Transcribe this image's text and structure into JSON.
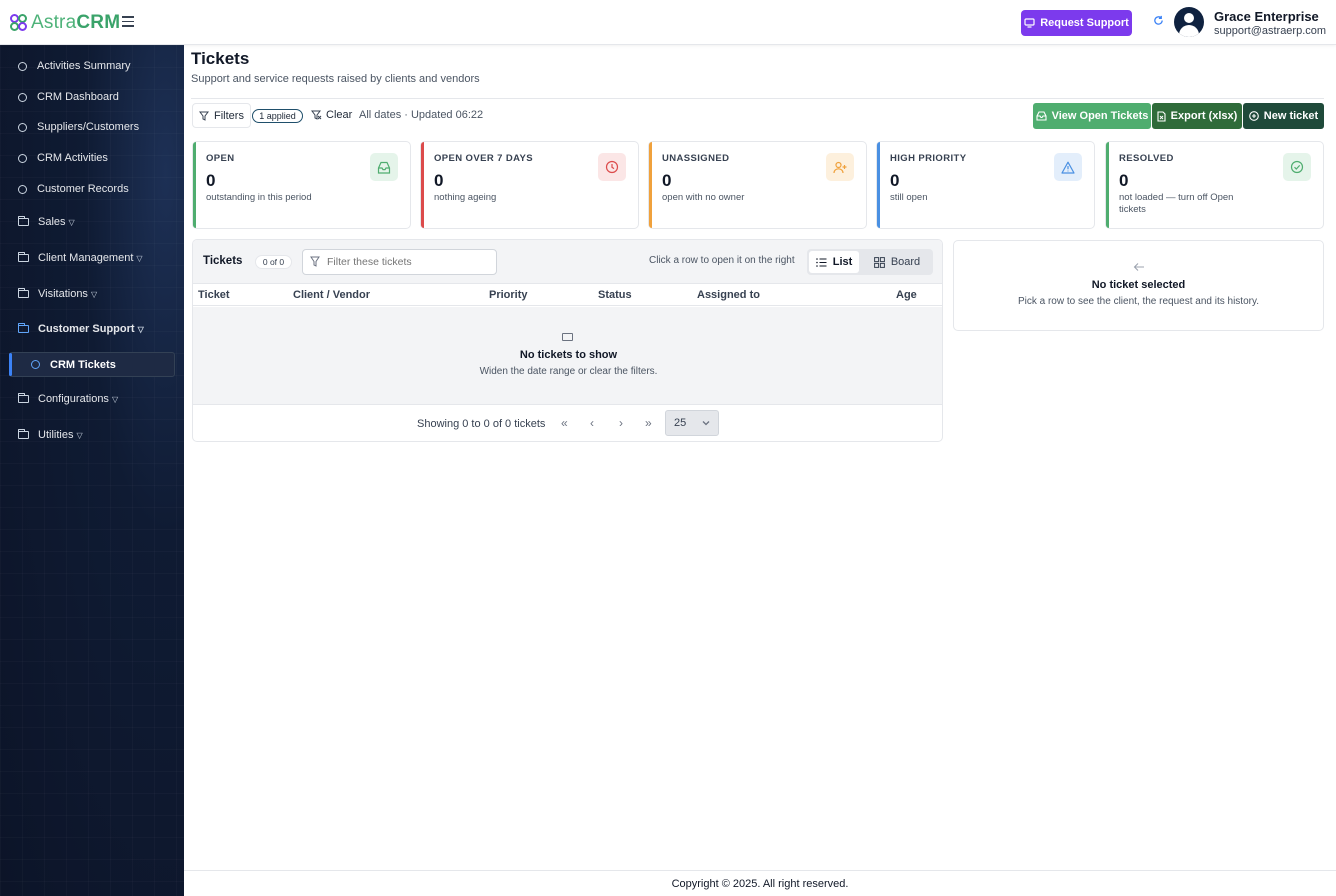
{
  "app": {
    "logo_prefix": "Astra",
    "logo_suffix": "CRM"
  },
  "header": {
    "request_support": "Request Support",
    "user_name": "Grace Enterprise",
    "user_email": "support@astraerp.com"
  },
  "sidebar": {
    "items": [
      {
        "label": "Activities Summary"
      },
      {
        "label": "CRM Dashboard"
      },
      {
        "label": "Suppliers/Customers"
      },
      {
        "label": "CRM Activities"
      },
      {
        "label": "Customer Records"
      },
      {
        "label": "Sales"
      },
      {
        "label": "Client Management"
      },
      {
        "label": "Visitations"
      },
      {
        "label": "Customer Support"
      },
      {
        "label": "CRM Tickets"
      },
      {
        "label": "Configurations"
      },
      {
        "label": "Utilities"
      }
    ]
  },
  "page": {
    "title": "Tickets",
    "subtitle": "Support and service requests raised by clients and vendors"
  },
  "toolbar": {
    "filters": "Filters",
    "applied": "1 applied",
    "clear": "Clear",
    "dates": "All dates · Updated 06:22",
    "view_open": "View Open Tickets",
    "export": "Export (xlsx)",
    "new_ticket": "New ticket"
  },
  "stats": [
    {
      "label": "OPEN",
      "value": "0",
      "note": "outstanding in this period",
      "color": "#4fad6f"
    },
    {
      "label": "OPEN OVER 7 DAYS",
      "value": "0",
      "note": "nothing ageing",
      "color": "#dc4b4b"
    },
    {
      "label": "UNASSIGNED",
      "value": "0",
      "note": "open with no owner",
      "color": "#f0a13c"
    },
    {
      "label": "HIGH PRIORITY",
      "value": "0",
      "note": "still open",
      "color": "#4a90e2"
    },
    {
      "label": "RESOLVED",
      "value": "0",
      "note": "not loaded — turn off Open tickets",
      "color": "#4fad6f"
    }
  ],
  "tickets": {
    "title": "Tickets",
    "count": "0 of 0",
    "filter_placeholder": "Filter these tickets",
    "hint": "Click a row to open it on the right",
    "view_list": "List",
    "view_board": "Board",
    "columns": [
      "Ticket",
      "Client / Vendor",
      "Priority",
      "Status",
      "Assigned to",
      "Age"
    ],
    "empty_title": "No tickets to show",
    "empty_sub": "Widen the date range or clear the filters.",
    "showing": "Showing 0 to 0 of 0 tickets",
    "per_page": "25"
  },
  "detail": {
    "title": "No ticket selected",
    "subtitle": "Pick a row to see the client, the request and its history."
  },
  "footer": {
    "text": "Copyright © 2025. All right reserved."
  }
}
